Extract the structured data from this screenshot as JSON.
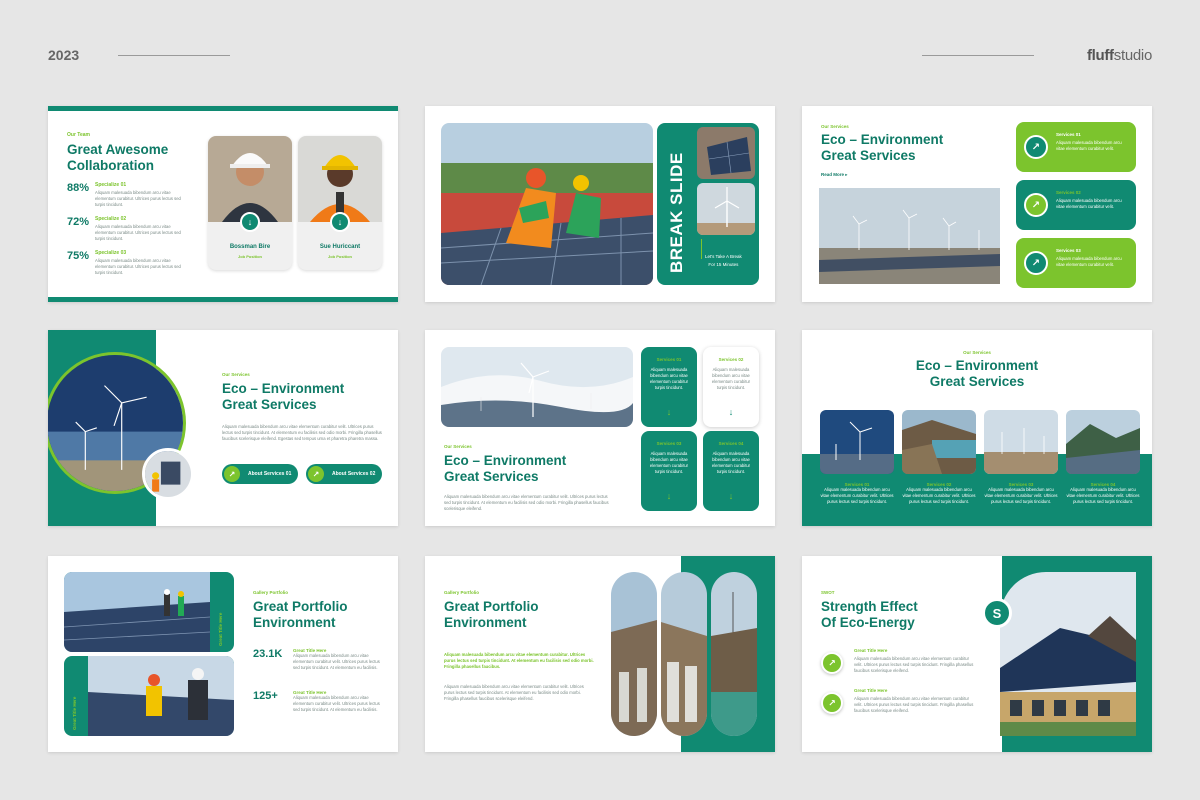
{
  "header": {
    "year": "2023",
    "brand_bold": "fluff",
    "brand_rest": "studio"
  },
  "s1": {
    "label": "Our Team",
    "title1": "Great Awesome",
    "title2": "Collaboration",
    "stats": [
      {
        "pct": "88%",
        "name": "Specialize 01"
      },
      {
        "pct": "72%",
        "name": "Specialize 02"
      },
      {
        "pct": "75%",
        "name": "Specialize 03"
      }
    ],
    "stat_text": "Aliquam malesuada bibendum arcu vitae elementum curabitur. Ultrices purus lectus sed turpis tincidunt.",
    "people": [
      {
        "name": "Bossman Bire",
        "role": "Job Position"
      },
      {
        "name": "Sue Huriccant",
        "role": "Job Position"
      }
    ]
  },
  "s2": {
    "title": "BREAK SLIDE",
    "sub1": "Let's Take A Break",
    "sub2": "For 15 Minutes"
  },
  "s3": {
    "label": "Our Services",
    "title1": "Eco – Environment",
    "title2": "Great Services",
    "readmore": "Read More",
    "services": [
      {
        "name": "Services 01"
      },
      {
        "name": "Services 02"
      },
      {
        "name": "Services 03"
      }
    ],
    "svc_text": "Aliquam malesuada bibendum arcu vitae elementum curabitur velit."
  },
  "s4": {
    "label": "Our Services",
    "title1": "Eco – Environment",
    "title2": "Great Services",
    "body": "Aliquam malesuada bibendum arcu vitae elementum curabitur velit. Ultrices purus lectus sed turpis tincidunt. At elementum eu facilisis sed odio morbi. Fringilla phasellus faucibus scelerisque eleifend. Egestas sed tempus urna et pharetra pharetra massa.",
    "btn1": "About Services 01",
    "btn2": "About Services 02"
  },
  "s5": {
    "label": "Our Services",
    "title1": "Eco – Environment",
    "title2": "Great Services",
    "body": "Aliquam malesuada bibendum arcu vitae elementum curabitur velit. Ultrices purus lectus sed turpis tincidunt. At elementum eu facilisis sed odio morbi. Fringilla phasellus faucibus scelerisque eleifend.",
    "cards": [
      {
        "name": "Services 01"
      },
      {
        "name": "Services 02"
      },
      {
        "name": "Services 03"
      },
      {
        "name": "Services 04"
      }
    ],
    "card_text": "Aliquam malesuada bibendum arcu vitae elementum curabitur turpis tincidunt."
  },
  "s6": {
    "label": "Our Services",
    "title1": "Eco – Environment",
    "title2": "Great Services",
    "cols": [
      {
        "name": "Services 01"
      },
      {
        "name": "Services 02"
      },
      {
        "name": "Services 03"
      },
      {
        "name": "Services 04"
      }
    ],
    "col_text": "Aliquam malesuada bibendum arcu vitae elementum curabitur velit. Ultrices purus lectus sed turpis tincidunt."
  },
  "s7": {
    "label": "Gallery Portfolio",
    "title1": "Great Portfolio",
    "title2": "Environment",
    "vtitle1": "Great Title Here",
    "vtitle2": "Great Title Here",
    "stats": [
      {
        "num": "23.1K",
        "name": "Great Title Here"
      },
      {
        "num": "125+",
        "name": "Great Title Here"
      }
    ],
    "stat_text": "Aliquam malesuada bibendum arcu vitae elementum curabitur velit. Ultrices purus lectus sed turpis tincidunt. At elementum eu facilisis."
  },
  "s8": {
    "label": "Gallery Portfolio",
    "title1": "Great Portfolio",
    "title2": "Environment",
    "body1": "Aliquam malesuada bibendum arcu vitae elementum curabitur. Ultrices purus lectus sed turpis tincidunt. At elementum eu facilisis sed odio morbi. Fringilla phasellus faucibus.",
    "body2": "Aliquam malesuada bibendum arcu vitae elementum curabitur velit. Ultrices purus lectus sed turpis tincidunt. At elementum eu facilisis sed odio morbi. Fringilla phasellus faucibus scelerisque eleifend."
  },
  "s9": {
    "label": "SWOT",
    "title1": "Strength Effect",
    "title2": "Of Eco-Energy",
    "badge": "S",
    "items": [
      {
        "name": "Great Title Here"
      },
      {
        "name": "Great Title Here"
      }
    ],
    "item_text": "Aliquam malesuada bibendum arcu vitae elementum curabitur velit. Ultrices purus lectus sed turpis tincidunt. Fringilla phasellus faucibus scelerisque eleifend."
  },
  "colors": {
    "teal": "#108a72",
    "lime": "#7cc42d",
    "background": "#e6e6e6"
  }
}
